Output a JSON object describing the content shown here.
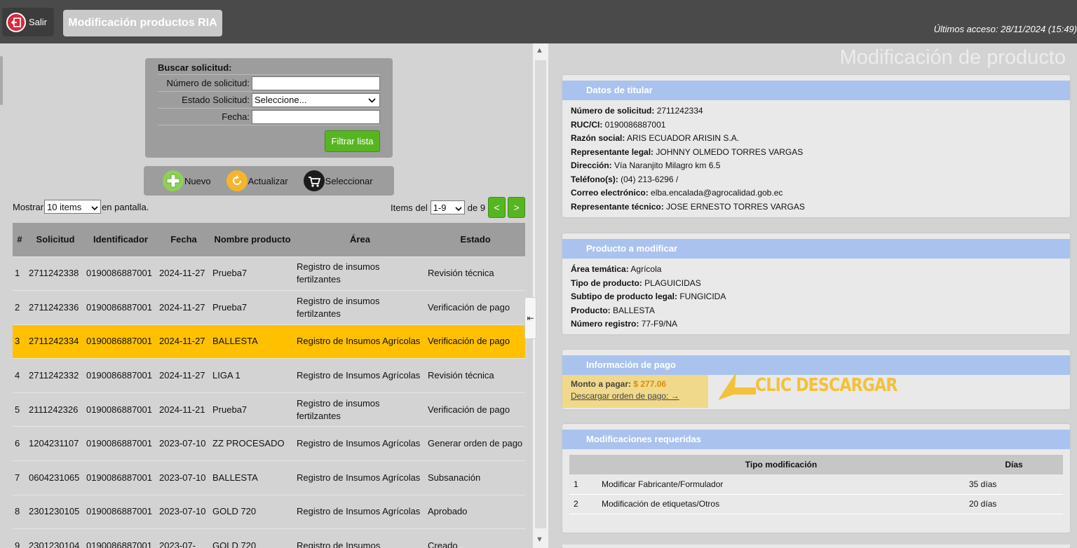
{
  "header": {
    "exit_label": "Salir",
    "app_title": "Modificación productos RIA",
    "last_access": "Últimos acceso: 28/11/2024 (15:49)"
  },
  "search": {
    "title": "Buscar solicitud:",
    "numero_label": "Número de solicitud:",
    "numero_value": "",
    "estado_label": "Estado Solicitud:",
    "estado_value": "Seleccione...",
    "fecha_label": "Fecha:",
    "fecha_value": "",
    "filter_button": "Filtrar lista"
  },
  "toolbar": {
    "nuevo": "Nuevo",
    "actualizar": "Actualizar",
    "seleccionar": "Seleccionar"
  },
  "listing": {
    "mostrar": "Mostrar",
    "page_size": "10 items",
    "en_pantalla": "en pantalla.",
    "items_del": "Items del",
    "range": "1-9",
    "de_total": "de 9",
    "prev": "<",
    "next": ">"
  },
  "table": {
    "headers": [
      "#",
      "Solicitud",
      "Identificador",
      "Fecha",
      "Nombre producto",
      "Área",
      "Estado"
    ],
    "rows": [
      {
        "n": "1",
        "solicitud": "2711242338",
        "identificador": "0190086887001",
        "fecha": "2024-11-27",
        "producto": "Prueba7",
        "area": "Registro de insumos fertilzantes",
        "estado": "Revisión técnica"
      },
      {
        "n": "2",
        "solicitud": "2711242336",
        "identificador": "0190086887001",
        "fecha": "2024-11-27",
        "producto": "Prueba7",
        "area": "Registro de insumos fertilzantes",
        "estado": "Verificación de pago"
      },
      {
        "n": "3",
        "solicitud": "2711242334",
        "identificador": "0190086887001",
        "fecha": "2024-11-27",
        "producto": "BALLESTA",
        "area": "Registro de Insumos Agrícolas",
        "estado": "Verificación de pago"
      },
      {
        "n": "4",
        "solicitud": "2711242332",
        "identificador": "0190086887001",
        "fecha": "2024-11-27",
        "producto": "LIGA 1",
        "area": "Registro de Insumos Agrícolas",
        "estado": "Revisión técnica"
      },
      {
        "n": "5",
        "solicitud": "2111242326",
        "identificador": "0190086887001",
        "fecha": "2024-11-21",
        "producto": "Prueba7",
        "area": "Registro de insumos fertilzantes",
        "estado": "Verificación de pago"
      },
      {
        "n": "6",
        "solicitud": "1204231107",
        "identificador": "0190086887001",
        "fecha": "2023-07-10",
        "producto": "ZZ PROCESADO",
        "area": "Registro de Insumos Agrícolas",
        "estado": "Generar orden de pago"
      },
      {
        "n": "7",
        "solicitud": "0604231065",
        "identificador": "0190086887001",
        "fecha": "2023-07-10",
        "producto": "BALLESTA",
        "area": "Registro de Insumos Agrícolas",
        "estado": "Subsanación"
      },
      {
        "n": "8",
        "solicitud": "2301230105",
        "identificador": "0190086887001",
        "fecha": "2023-07-10",
        "producto": "GOLD 720",
        "area": "Registro de Insumos Agrícolas",
        "estado": "Aprobado"
      },
      {
        "n": "9",
        "solicitud": "2301230104",
        "identificador": "0190086887001",
        "fecha": "2023-07-",
        "producto": "GOLD 720",
        "area": "Registro de Insumos",
        "estado": "Creado"
      }
    ]
  },
  "detail": {
    "title": "Modificación de producto",
    "titular": {
      "heading": "Datos de titular",
      "fields": [
        {
          "label": "Número de solicitud:",
          "value": "2711242334"
        },
        {
          "label": "RUC/CI:",
          "value": "0190086887001"
        },
        {
          "label": "Razón social:",
          "value": "ARIS ECUADOR ARISIN S.A."
        },
        {
          "label": "Representante legal:",
          "value": "JOHNNY OLMEDO TORRES VARGAS"
        },
        {
          "label": "Dirección:",
          "value": "Vía Naranjito Milagro km 6.5"
        },
        {
          "label": "Teléfono(s):",
          "value": "(04) 213-6296 /"
        },
        {
          "label": "Correo electrónico:",
          "value": "elba.encalada@agrocalidad.gob.ec"
        },
        {
          "label": "Representante técnico:",
          "value": "JOSE ERNESTO TORRES VARGAS"
        }
      ]
    },
    "producto": {
      "heading": "Producto a modificar",
      "fields": [
        {
          "label": "Área temática:",
          "value": "Agrícola"
        },
        {
          "label": "Tipo de producto:",
          "value": "PLAGUICIDAS"
        },
        {
          "label": "Subtipo de producto legal:",
          "value": "FUNGICIDA"
        },
        {
          "label": "Producto:",
          "value": "BALLESTA"
        },
        {
          "label": "Número registro:",
          "value": "77-F9/NA"
        }
      ]
    },
    "pago": {
      "heading": "Información de pago",
      "monto_label": "Monto a pagar:",
      "monto_value": "$ 277.06",
      "download_link": "Descargar orden de pago: →",
      "annotation": "CLIC DESCARGAR"
    },
    "modificaciones": {
      "heading": "Modificaciones requeridas",
      "headers": [
        "Tipo modificación",
        "Días"
      ],
      "rows": [
        {
          "n": "1",
          "tipo": "Modificar Fabricante/Formulador",
          "dias": "35 días"
        },
        {
          "n": "2",
          "tipo": "Modificación de etiquetas/Otros",
          "dias": "20 días"
        }
      ]
    }
  },
  "colors": {
    "accent_green": "#57b522",
    "selected_row": "#ffc000",
    "card_header": "#a9c3ee",
    "annotation": "#f3c13a"
  }
}
